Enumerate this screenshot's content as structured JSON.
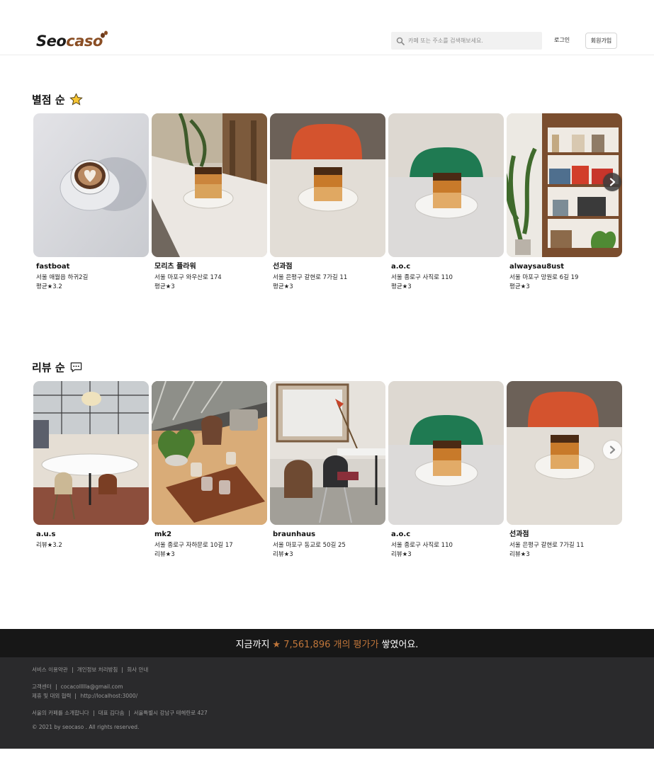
{
  "header": {
    "logo_main": "Seo",
    "logo_accent": "caso",
    "search_placeholder": "카페 또는 주소를 검색해보세요.",
    "login_label": "로그인",
    "signup_label": "회원가입"
  },
  "rating_section": {
    "title": "별점 순",
    "icon": "star-icon",
    "cards": [
      {
        "name": "fastboat",
        "address": "서울 애월읍 하귀2길",
        "rating": "평균★3.2"
      },
      {
        "name": "모리츠 플라워",
        "address": "서울 마포구 와우산로 174",
        "rating": "평균★3"
      },
      {
        "name": "선과점",
        "address": "서울 은평구 갈현로 7가길 11",
        "rating": "평균★3"
      },
      {
        "name": "a.o.c",
        "address": "서울 종로구 사직로 110",
        "rating": "평균★3"
      },
      {
        "name": "alwaysau8ust",
        "address": "서울 마포구 망원로 6길 19",
        "rating": "평균★3"
      }
    ]
  },
  "review_section": {
    "title": "리뷰 순",
    "icon": "chat-bubble-icon",
    "cards": [
      {
        "name": "a.u.s",
        "address": "",
        "rating": "리뷰★3.2"
      },
      {
        "name": "mk2",
        "address": "서울 종로구 자하문로 10길 17",
        "rating": "리뷰★3"
      },
      {
        "name": "braunhaus",
        "address": "서울 마포구 동교로 50길 25",
        "rating": "리뷰★3"
      },
      {
        "name": "a.o.c",
        "address": "서울 종로구 사직로 110",
        "rating": "리뷰★3"
      },
      {
        "name": "선과점",
        "address": "서울 은평구 갈현로 7가길 11",
        "rating": "리뷰★3"
      }
    ]
  },
  "footer_band": {
    "prefix": "지금까지",
    "count": "★ 7,561,896 개의 평가가",
    "suffix": "쌓였어요."
  },
  "footer": {
    "links": [
      "서비스 이용약관",
      "개인정보 처리방침",
      "회사 안내"
    ],
    "support_label": "고객센터",
    "support_email": "cocacollllla@gmail.com",
    "partner_label": "제휴 및 대외 협력",
    "partner_url": "http://localhost:3000/",
    "company_intro": "서울의 카페를 소개합니다",
    "ceo": "대표 김다솜",
    "address": "서울특별시 강남구 테헤란로 427",
    "copyright": "© 2021 by seocaso . All rights reserved."
  },
  "colors": {
    "brand": "#8a4e24",
    "accent": "#c0763a",
    "footer_bg": "#2a2a2c",
    "band_bg": "#171717"
  }
}
